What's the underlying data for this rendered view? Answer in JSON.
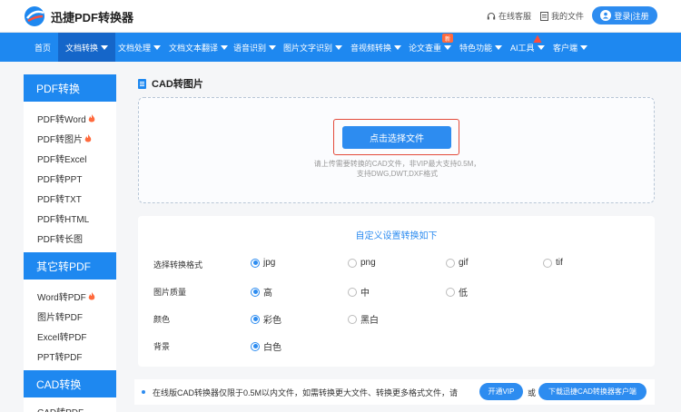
{
  "header": {
    "brand": "迅捷PDF转换器",
    "service_label": "在线客服",
    "myfiles_label": "我的文件",
    "login_label": "登录|注册"
  },
  "nav": {
    "items": [
      {
        "label": "首页"
      },
      {
        "label": "文档转换"
      },
      {
        "label": "文档处理"
      },
      {
        "label": "文档文本翻译"
      },
      {
        "label": "语音识别"
      },
      {
        "label": "图片文字识别"
      },
      {
        "label": "音视频转换"
      },
      {
        "label": "论文查重"
      },
      {
        "label": "特色功能"
      },
      {
        "label": "AI工具"
      },
      {
        "label": "客户端"
      }
    ],
    "badge_new": "新"
  },
  "sidebar": {
    "sections": [
      {
        "title": "PDF转换",
        "items": [
          "PDF转Word",
          "PDF转图片",
          "PDF转Excel",
          "PDF转PPT",
          "PDF转TXT",
          "PDF转HTML",
          "PDF转长图"
        ]
      },
      {
        "title": "其它转PDF",
        "items": [
          "Word转PDF",
          "图片转PDF",
          "Excel转PDF",
          "PPT转PDF"
        ]
      },
      {
        "title": "CAD转换",
        "items": [
          "CAD转PDF"
        ]
      }
    ]
  },
  "main": {
    "title": "CAD转图片",
    "upload_button": "点击选择文件",
    "upload_hint_1": "请上传需要转换的CAD文件，非VIP最大支持0.5M，",
    "upload_hint_2": "支持DWG,DWT,DXF格式",
    "settings_title": "自定义设置转换如下",
    "rows": [
      {
        "label": "选择转换格式",
        "options": [
          "jpg",
          "png",
          "gif",
          "tif"
        ],
        "selected": "jpg"
      },
      {
        "label": "图片质量",
        "options": [
          "高",
          "中",
          "低"
        ],
        "selected": "高"
      },
      {
        "label": "颜色",
        "options": [
          "彩色",
          "黑白"
        ],
        "selected": "彩色"
      },
      {
        "label": "背景",
        "options": [
          "白色"
        ],
        "selected": "白色"
      }
    ],
    "notice": "在线版CAD转换器仅限于0.5M以内文件，如需转换更大文件、转换更多格式文件，请",
    "notice_or": "或",
    "vip_button": "开通VIP",
    "download_button": "下载迅捷CAD转换器客户端"
  },
  "colors": {
    "primary": "#1e88f0",
    "accent": "#2d8cf0",
    "highlight": "#e34a3a",
    "hot": "#ff6a3d"
  }
}
